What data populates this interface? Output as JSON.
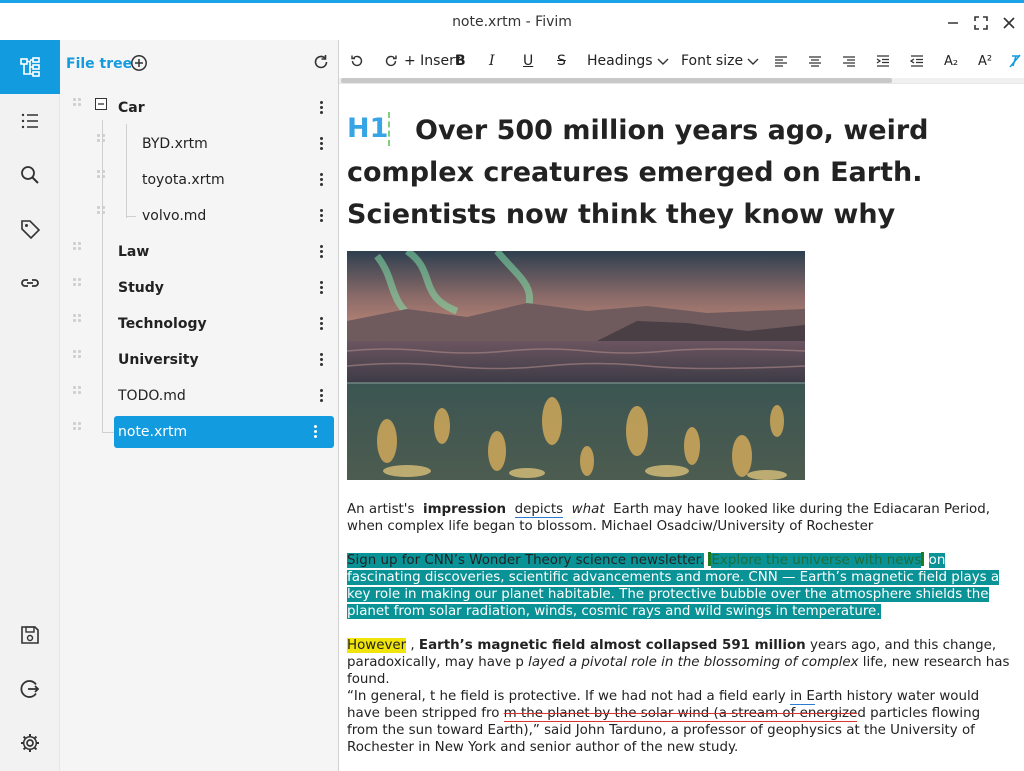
{
  "window": {
    "title": "note.xrtm - Fivim"
  },
  "rail": {
    "items": [
      {
        "icon": "file-tree-icon",
        "active": true
      },
      {
        "icon": "outline-list-icon"
      },
      {
        "icon": "search-icon"
      },
      {
        "icon": "tag-icon"
      },
      {
        "icon": "link-icon"
      }
    ],
    "bottom": [
      {
        "icon": "save-icon"
      },
      {
        "icon": "logout-icon"
      },
      {
        "icon": "settings-gear-icon"
      }
    ]
  },
  "tree": {
    "title": "File tree",
    "items": [
      {
        "label": "Car",
        "level": 0,
        "bold": true,
        "expanded": true
      },
      {
        "label": "BYD.xrtm",
        "level": 1
      },
      {
        "label": "toyota.xrtm",
        "level": 1
      },
      {
        "label": "volvo.md",
        "level": 1
      },
      {
        "label": "Law",
        "level": 0,
        "bold": true
      },
      {
        "label": "Study",
        "level": 0,
        "bold": true
      },
      {
        "label": "Technology",
        "level": 0,
        "bold": true
      },
      {
        "label": "University",
        "level": 0,
        "bold": true
      },
      {
        "label": "TODO.md",
        "level": 0
      },
      {
        "label": "note.xrtm",
        "level": 0,
        "selected": true
      }
    ]
  },
  "toolbar": {
    "insert_label": "+ Insert",
    "bold_label": "B",
    "italic_label": "I",
    "underline_label": "U",
    "strike_label": "S",
    "headings_label": "Headings",
    "fontsize_label": "Font size",
    "subscript_label": "A₂",
    "superscript_label": "A²"
  },
  "document": {
    "heading_tag": "H1",
    "heading": "Over 500 million years ago, weird complex creatures emerged on Earth. Scientists now think they know why",
    "caption": {
      "a": "An artist's",
      "b": "impression",
      "c": "depicts",
      "d": "what",
      "e": "Earth may have looked like during the Ediacaran Period, when complex life began to blossom. Michael Osadciw/University of Rochester"
    },
    "para2": {
      "a": "Sign up for CNN’s Wonder Theory science newsletter.",
      "b": "Explore the universe with news",
      "c": "on fascinating discoveries, scientific advancements and more. CNN — Earth’s magnetic field plays a key role in making our planet habitable. The protective bubble over the atmosphere shields the planet from solar radiation, winds, cosmic rays and wild swings in temperature."
    },
    "para3": {
      "a": "However",
      "b": ",",
      "c": "Earth’s magnetic field almost collapsed 591 million",
      "d": "years ago, and this change, paradoxically, may have p",
      "e": "layed a pivotal role in the blossoming of complex",
      "f": "life, new research has found."
    },
    "para4": {
      "a": "“In general, t he field is protective. If we had not had a field early",
      "b": "in E",
      "c": "arth history water would have been stripped fro",
      "d": "m the planet by the solar wind (a stream of energize",
      "e": "d particles flowing from the sun toward Earth),” said John Tarduno, a professor of geophysics at the University of Rochester in New York and senior author of the new study."
    }
  },
  "colors": {
    "accent": "#139be0",
    "heading_tag": "#37a4e6",
    "teal_highlight": "#0a9396",
    "yellow_highlight": "#f0e40a"
  }
}
